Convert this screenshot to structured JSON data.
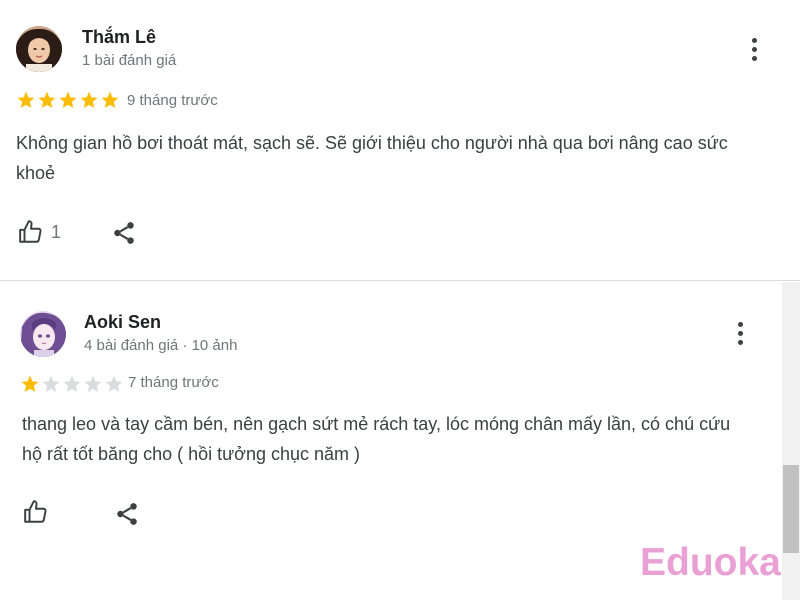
{
  "reviews": [
    {
      "author": "Thắm Lê",
      "meta": "1 bài đánh giá",
      "rating": 5,
      "time": "9 tháng trước",
      "text": "Không gian hồ bơi thoát mát, sạch sẽ. Sẽ giới thiệu cho người nhà qua bơi nâng cao sức khoẻ",
      "likes": "1"
    },
    {
      "author": "Aoki Sen",
      "meta": "4 bài đánh giá · 10 ảnh",
      "rating": 1,
      "time": "7 tháng trước",
      "text": "thang leo và tay cầm bén, nên gạch sứt mẻ rách tay, lóc móng chân mấy lần, có chú cứu hộ rất tốt băng cho ( hồi tưởng chục năm )",
      "likes": ""
    }
  ],
  "icons": {
    "star": "star-icon",
    "like": "thumbs-up-icon",
    "share": "share-icon",
    "more": "more-vert-icon"
  },
  "colors": {
    "star_filled": "#fbbc04",
    "star_empty": "#dadce0",
    "watermark": "#e9a0d4"
  },
  "watermark": "Eduoka"
}
